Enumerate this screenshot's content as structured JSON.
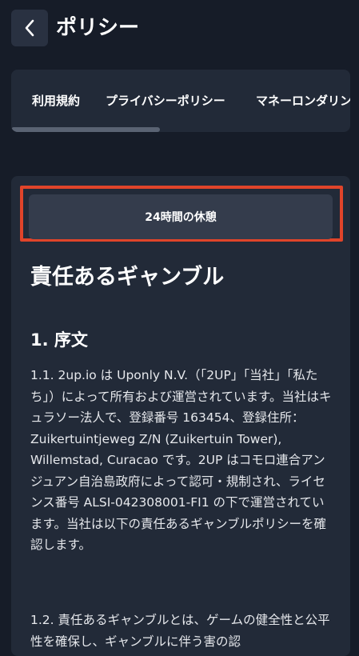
{
  "header": {
    "title": "ポリシー"
  },
  "tabs": [
    {
      "label": "利用規約"
    },
    {
      "label": "プライバシーポリシー"
    },
    {
      "label": "マネーロンダリン"
    }
  ],
  "content": {
    "break_button": "24時間の休憩",
    "heading": "責任あるギャンブル",
    "section_title": "1. 序文",
    "paragraph_1": "1.1. 2up.io は Uponly N.V.（「2UP」「当社」「私たち」）によって所有および運営されています。当社はキュラソー法人で、登録番号 163454、登録住所：Zuikertuintjeweg Z/N (Zuikertuin Tower), Willemstad, Curacao です。2UP はコモロ連合アンジュアン自治島政府によって認可・規制され、ライセンス番号 ALSI-042308001-FI1 の下で運営されています。当社は以下の責任あるギャンブルポリシーを確認します。",
    "paragraph_2": "1.2. 責任あるギャンブルとは、ゲームの健全性と公平性を確保し、ギャンブルに伴う害の認"
  },
  "colors": {
    "background": "#161c28",
    "card": "#222a38",
    "button": "#343c4c",
    "highlight": "#e0442a"
  }
}
